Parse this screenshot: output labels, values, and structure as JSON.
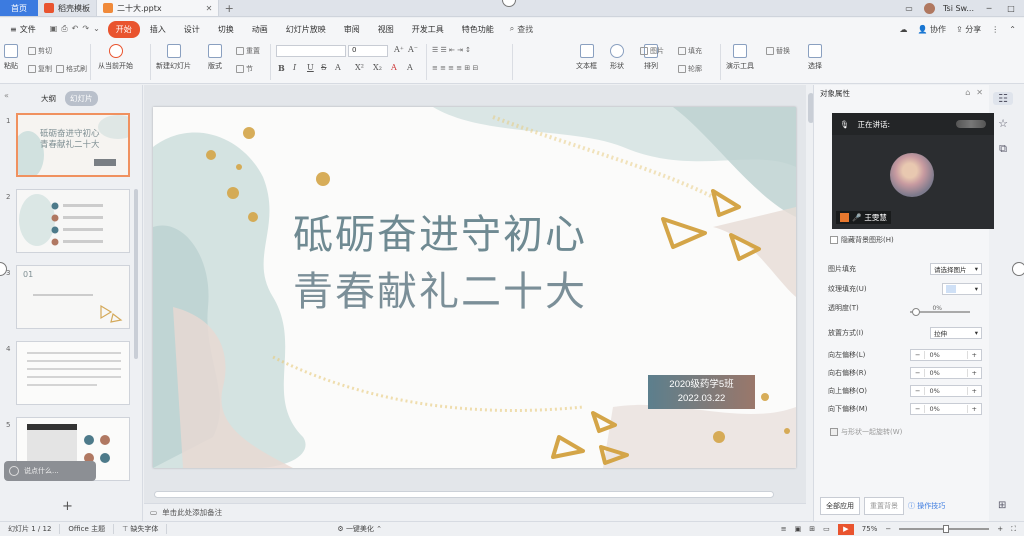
{
  "colors": {
    "accent": "#e9542f",
    "home": "#3c7be0",
    "title1": "#6f8a92",
    "title2": "#7b8f98"
  },
  "tabs": {
    "home_label": "首页",
    "items": [
      {
        "label": "稻壳模板",
        "badge_color": "#e9542f"
      },
      {
        "label": "二十大.pptx",
        "badge_color": "#f08a3a"
      }
    ],
    "user_label": "Tsi Sw..."
  },
  "menu": {
    "file_label": "文件",
    "items": [
      "开始",
      "插入",
      "设计",
      "切换",
      "动画",
      "幻灯片放映",
      "审阅",
      "视图",
      "开发工具",
      "特色功能"
    ],
    "active_index": 0,
    "search_label": "查找",
    "collab_label": "协作",
    "share_label": "分享"
  },
  "ribbon": {
    "paste": "粘贴",
    "cut": "剪切",
    "copy": "复制",
    "format_painter": "格式刷",
    "from_start": "从当前开始",
    "new_slide": "新建幻灯片",
    "layout": "版式",
    "section": "节",
    "reset": "重置",
    "font_size_value": "0",
    "textbox": "文本框",
    "shape": "形状",
    "arrange": "排列",
    "picture": "图片",
    "fill": "填充",
    "outline": "轮廓",
    "presenter": "演示工具",
    "replace": "替换",
    "select": "选择",
    "format_letters": [
      "B",
      "I",
      "U",
      "S",
      "A",
      "X²",
      "X₂",
      "A",
      "A"
    ]
  },
  "left_panel": {
    "tab_outline": "大纲",
    "tab_slides": "幻灯片",
    "thumb1_title_line1": "砥砺奋进守初心",
    "thumb1_title_line2": "青春献礼二十大",
    "thumb3_label": "01",
    "chat_placeholder": "说点什么..."
  },
  "slide": {
    "title_line1": "砥砺奋进守初心",
    "title_line2": "青春献礼二十大",
    "class_label": "2020级药学5班",
    "date_label": "2022.03.22",
    "notes_placeholder": "单击此处添加备注"
  },
  "right_panel": {
    "header": "对象属性",
    "hide_bg": "隐藏背景图形(H)",
    "picture_fill_label": "图片填充",
    "picture_fill_value": "请选择图片",
    "texture_label": "纹理填充(U)",
    "transparency_label": "透明度(T)",
    "transparency_value": "0%",
    "placement_label": "放置方式(I)",
    "placement_value": "拉伸",
    "offset_left_label": "向左偏移(L)",
    "offset_right_label": "向右偏移(R)",
    "offset_up_label": "向上偏移(O)",
    "offset_down_label": "向下偏移(M)",
    "offset_value": "0%",
    "rotate_with_shape": "与形状一起旋转(W)",
    "apply_all": "全部应用",
    "reset_bg": "重置背景",
    "tips": "操作技巧"
  },
  "video": {
    "speaking_label": "正在讲话:",
    "participant_name": "王雯慧"
  },
  "status": {
    "slide_counter": "幻灯片 1 / 12",
    "theme": "Office 主题",
    "missing_font": "缺失字体",
    "beautify": "一键美化",
    "zoom": "75%"
  }
}
